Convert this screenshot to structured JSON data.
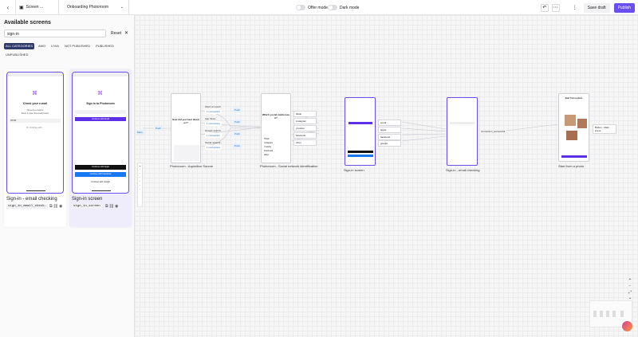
{
  "topbar": {
    "screen_label": "Screen ...",
    "flow_label": "Onboarding Photoroom",
    "offer_mode": "Offer mode",
    "dark_mode": "Dark mode",
    "save_draft": "Save draft",
    "publish": "Publish"
  },
  "sidebar": {
    "title": "Available screens",
    "search_value": "sign-in",
    "reset": "Reset",
    "chips": [
      "ALL CATEGORIES",
      "AMO",
      "LIVIA",
      "NOT PUBLISHED",
      "PUBLISHED",
      "UNPUBLISHED"
    ],
    "cards": [
      {
        "name": "Sign-in - email checking",
        "code": "sign_in_email_check…",
        "phone_title": "Check your e-mail",
        "phone_text": "We sent a email to",
        "phone_text2": "Enter it (open the email) below",
        "phone_field": "OTCB",
        "phone_link": "Or, Continue with…"
      },
      {
        "name": "Sign-in screen",
        "code": "sign_in_screen",
        "phone_title": "Sign in to Photoroom",
        "phone_btn1": "Continue with Email",
        "phone_btn2": "Continue with Apple",
        "phone_btn3": "Continue with Facebook",
        "phone_btn4": "Continue with Google"
      }
    ]
  },
  "canvas": {
    "left_pills": [
      "Main",
      "Push"
    ],
    "acquisition": {
      "label": "Photoroom - Aquisition Source",
      "question": "How did you hear about us?",
      "options": [
        {
          "name": "Word of mouth",
          "count": "1 connection"
        },
        {
          "name": "App Store",
          "count": "1 connection"
        },
        {
          "name": "Google search",
          "count": "1 connection"
        },
        {
          "name": "Social network",
          "count": "1 connection"
        }
      ],
      "push": "Push"
    },
    "social": {
      "label": "Photoroom - Social network identification",
      "question": "Which social media was it?",
      "rows": [
        "Tiktok",
        "Instagram",
        "Youtube",
        "Facebook",
        "Other"
      ],
      "options": [
        "tiktok",
        "instagram",
        "youtube",
        "facebook",
        "other"
      ]
    },
    "signin": {
      "label": "Sign-in screen",
      "options": [
        "email",
        "apple",
        "facebook",
        "google"
      ]
    },
    "email_check": {
      "label": "Sign-in - email checking",
      "option": "connection_successful"
    },
    "start_photo": {
      "label": "Start from a photo",
      "title": "Start from a photo",
      "side_btn": "Button - Main press"
    }
  }
}
